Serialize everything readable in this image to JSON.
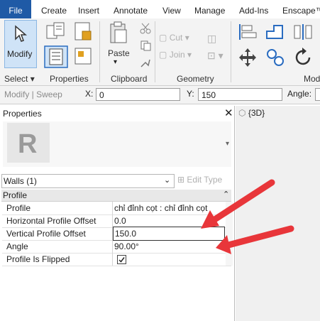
{
  "menu": {
    "items": [
      "File",
      "Create",
      "Insert",
      "Annotate",
      "View",
      "Manage",
      "Add-Ins",
      "Enscape™"
    ]
  },
  "ribbon": {
    "modify_label": "Modify",
    "paste_label": "Paste",
    "cut_label": "Cut",
    "join_label": "Join",
    "groups": {
      "select": "Select",
      "properties": "Properties",
      "clipboard": "Clipboard",
      "geometry": "Geometry",
      "modify_partial": "Mod"
    }
  },
  "optionsbar": {
    "context": "Modify | Sweep",
    "x_label": "X:",
    "x_value": "0",
    "y_label": "Y:",
    "y_value": "150",
    "angle_label": "Angle:"
  },
  "properties_panel": {
    "title": "Properties",
    "type_selector": "Walls (1)",
    "edit_type": "Edit Type",
    "section": "Profile",
    "rows": [
      {
        "key": "Profile",
        "value": "chỉ đỉnh cọt : chỉ đỉnh cọt"
      },
      {
        "key": "Horizontal Profile Offset",
        "value": "0.0"
      },
      {
        "key": "Vertical Profile Offset",
        "value": "150.0"
      },
      {
        "key": "Angle",
        "value": "90.00°"
      },
      {
        "key": "Profile Is Flipped",
        "value": ""
      }
    ]
  },
  "view_tab": {
    "label": "{3D}"
  },
  "colors": {
    "file_menu": "#1f5aa6",
    "annotation_arrow": "#e8363a",
    "selection_blue": "#cfe3f7"
  }
}
